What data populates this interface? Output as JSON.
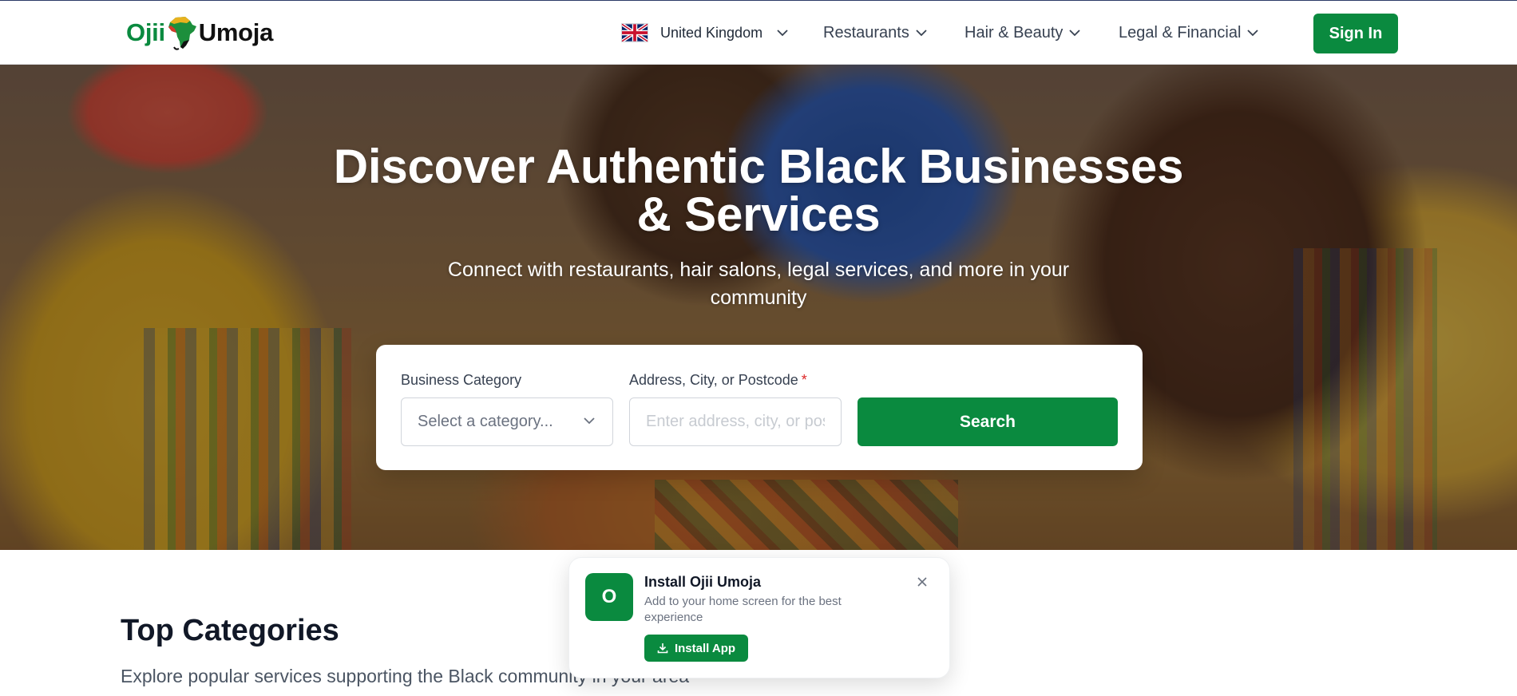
{
  "header": {
    "logo": {
      "left": "Ojii",
      "right": "Umoja"
    },
    "country": {
      "label": "United Kingdom",
      "flag": "uk-flag-icon"
    },
    "nav": [
      {
        "label": "Restaurants"
      },
      {
        "label": "Hair & Beauty"
      },
      {
        "label": "Legal & Financial"
      }
    ],
    "signin_label": "Sign In"
  },
  "hero": {
    "title_line1": "Discover Authentic Black Businesses",
    "title_line2": "& Services",
    "subtitle": "Connect with restaurants, hair salons, legal services, and more in your community"
  },
  "search": {
    "category_label": "Business Category",
    "category_placeholder": "Select a category...",
    "address_label": "Address, City, or Postcode",
    "address_required_mark": "*",
    "address_placeholder": "Enter address, city, or postcode",
    "button_label": "Search"
  },
  "categories": {
    "title": "Top Categories",
    "subtitle": "Explore popular services supporting the Black community in your area"
  },
  "install_prompt": {
    "icon_letter": "O",
    "title": "Install Ojii Umoja",
    "description": "Add to your home screen for the best experience",
    "button_label": "Install App"
  },
  "colors": {
    "brand_green": "#0a8a3f",
    "required_red": "#dc2626"
  }
}
